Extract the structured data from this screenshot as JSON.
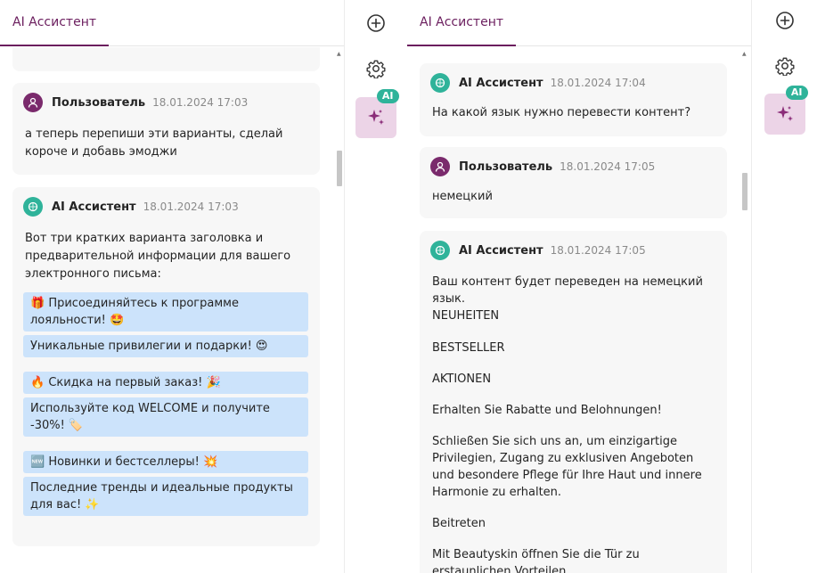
{
  "left_panel": {
    "tab": "AI Ассистент",
    "messages": [
      {
        "author": "Пользователь",
        "time": "18.01.2024 17:03",
        "text": "а теперь перепиши эти варианты, сделай короче и добавь эмоджи"
      },
      {
        "author": "AI Ассистент",
        "time": "18.01.2024 17:03",
        "intro": "Вот три кратких варианта заголовка и предварительной информации для вашего электронного письма:",
        "chips": [
          "🎁 Присоединяйтесь к программе лояльности! 🤩",
          "Уникальные привилегии и подарки! 😍",
          "🔥 Скидка на первый заказ! 🎉",
          "Используйте код WELCOME и получите -30%! 🏷️",
          "🆕 Новинки и бестселлеры! 💥",
          "Последние тренды и идеальные продукты для вас! ✨"
        ]
      }
    ]
  },
  "right_panel": {
    "tab": "AI Ассистент",
    "messages": [
      {
        "author": "AI Ассистент",
        "time": "18.01.2024 17:04",
        "text": "На какой язык нужно перевести контент?"
      },
      {
        "author": "Пользователь",
        "time": "18.01.2024 17:05",
        "text": "немецкий"
      },
      {
        "author": "AI Ассистент",
        "time": "18.01.2024 17:05",
        "lines": [
          "Ваш контент будет переведен на немецкий язык.\nNEUHEITEN",
          "BESTSELLER",
          "AKTIONEN",
          "Erhalten Sie Rabatte und Belohnungen!",
          "Schließen Sie sich uns an, um einzigartige Privilegien, Zugang zu exklusiven Angeboten und besondere Pflege für Ihre Haut und innere Harmonie zu erhalten.",
          "Beitreten",
          "Mit Beautyskin öffnen Sie die Tür zu erstaunlichen Vorteilen"
        ]
      }
    ]
  },
  "rail": {
    "badge": "AI",
    "icons": [
      "add-circle-icon",
      "gear-icon",
      "sparkle-icon"
    ]
  },
  "colors": {
    "accent": "#6b1e5e",
    "user_avatar": "#7a2a6c",
    "ai_avatar": "#2fb39a",
    "chip": "#cce3fb",
    "ai_button": "#ecd4e7"
  }
}
